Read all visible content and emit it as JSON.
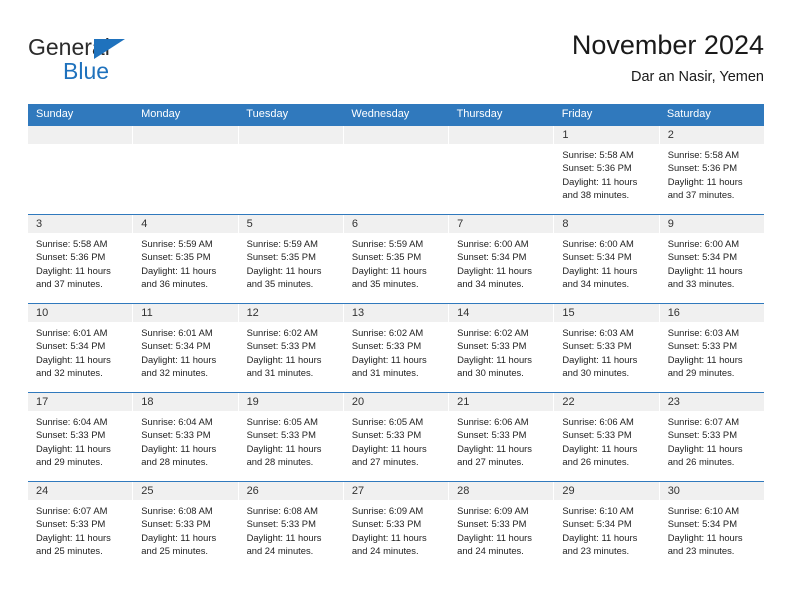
{
  "brand": {
    "name_part1": "General",
    "name_part2": "Blue",
    "accent_color": "#1f72bd"
  },
  "header": {
    "title": "November 2024",
    "location": "Dar an Nasir, Yemen"
  },
  "calendar": {
    "header_color": "#3079bd",
    "weekdays": [
      "Sunday",
      "Monday",
      "Tuesday",
      "Wednesday",
      "Thursday",
      "Friday",
      "Saturday"
    ],
    "weeks": [
      [
        {
          "day": "",
          "sunrise": "",
          "sunset": "",
          "daylight": "",
          "daylight2": ""
        },
        {
          "day": "",
          "sunrise": "",
          "sunset": "",
          "daylight": "",
          "daylight2": ""
        },
        {
          "day": "",
          "sunrise": "",
          "sunset": "",
          "daylight": "",
          "daylight2": ""
        },
        {
          "day": "",
          "sunrise": "",
          "sunset": "",
          "daylight": "",
          "daylight2": ""
        },
        {
          "day": "",
          "sunrise": "",
          "sunset": "",
          "daylight": "",
          "daylight2": ""
        },
        {
          "day": "1",
          "sunrise": "Sunrise: 5:58 AM",
          "sunset": "Sunset: 5:36 PM",
          "daylight": "Daylight: 11 hours",
          "daylight2": "and 38 minutes."
        },
        {
          "day": "2",
          "sunrise": "Sunrise: 5:58 AM",
          "sunset": "Sunset: 5:36 PM",
          "daylight": "Daylight: 11 hours",
          "daylight2": "and 37 minutes."
        }
      ],
      [
        {
          "day": "3",
          "sunrise": "Sunrise: 5:58 AM",
          "sunset": "Sunset: 5:36 PM",
          "daylight": "Daylight: 11 hours",
          "daylight2": "and 37 minutes."
        },
        {
          "day": "4",
          "sunrise": "Sunrise: 5:59 AM",
          "sunset": "Sunset: 5:35 PM",
          "daylight": "Daylight: 11 hours",
          "daylight2": "and 36 minutes."
        },
        {
          "day": "5",
          "sunrise": "Sunrise: 5:59 AM",
          "sunset": "Sunset: 5:35 PM",
          "daylight": "Daylight: 11 hours",
          "daylight2": "and 35 minutes."
        },
        {
          "day": "6",
          "sunrise": "Sunrise: 5:59 AM",
          "sunset": "Sunset: 5:35 PM",
          "daylight": "Daylight: 11 hours",
          "daylight2": "and 35 minutes."
        },
        {
          "day": "7",
          "sunrise": "Sunrise: 6:00 AM",
          "sunset": "Sunset: 5:34 PM",
          "daylight": "Daylight: 11 hours",
          "daylight2": "and 34 minutes."
        },
        {
          "day": "8",
          "sunrise": "Sunrise: 6:00 AM",
          "sunset": "Sunset: 5:34 PM",
          "daylight": "Daylight: 11 hours",
          "daylight2": "and 34 minutes."
        },
        {
          "day": "9",
          "sunrise": "Sunrise: 6:00 AM",
          "sunset": "Sunset: 5:34 PM",
          "daylight": "Daylight: 11 hours",
          "daylight2": "and 33 minutes."
        }
      ],
      [
        {
          "day": "10",
          "sunrise": "Sunrise: 6:01 AM",
          "sunset": "Sunset: 5:34 PM",
          "daylight": "Daylight: 11 hours",
          "daylight2": "and 32 minutes."
        },
        {
          "day": "11",
          "sunrise": "Sunrise: 6:01 AM",
          "sunset": "Sunset: 5:34 PM",
          "daylight": "Daylight: 11 hours",
          "daylight2": "and 32 minutes."
        },
        {
          "day": "12",
          "sunrise": "Sunrise: 6:02 AM",
          "sunset": "Sunset: 5:33 PM",
          "daylight": "Daylight: 11 hours",
          "daylight2": "and 31 minutes."
        },
        {
          "day": "13",
          "sunrise": "Sunrise: 6:02 AM",
          "sunset": "Sunset: 5:33 PM",
          "daylight": "Daylight: 11 hours",
          "daylight2": "and 31 minutes."
        },
        {
          "day": "14",
          "sunrise": "Sunrise: 6:02 AM",
          "sunset": "Sunset: 5:33 PM",
          "daylight": "Daylight: 11 hours",
          "daylight2": "and 30 minutes."
        },
        {
          "day": "15",
          "sunrise": "Sunrise: 6:03 AM",
          "sunset": "Sunset: 5:33 PM",
          "daylight": "Daylight: 11 hours",
          "daylight2": "and 30 minutes."
        },
        {
          "day": "16",
          "sunrise": "Sunrise: 6:03 AM",
          "sunset": "Sunset: 5:33 PM",
          "daylight": "Daylight: 11 hours",
          "daylight2": "and 29 minutes."
        }
      ],
      [
        {
          "day": "17",
          "sunrise": "Sunrise: 6:04 AM",
          "sunset": "Sunset: 5:33 PM",
          "daylight": "Daylight: 11 hours",
          "daylight2": "and 29 minutes."
        },
        {
          "day": "18",
          "sunrise": "Sunrise: 6:04 AM",
          "sunset": "Sunset: 5:33 PM",
          "daylight": "Daylight: 11 hours",
          "daylight2": "and 28 minutes."
        },
        {
          "day": "19",
          "sunrise": "Sunrise: 6:05 AM",
          "sunset": "Sunset: 5:33 PM",
          "daylight": "Daylight: 11 hours",
          "daylight2": "and 28 minutes."
        },
        {
          "day": "20",
          "sunrise": "Sunrise: 6:05 AM",
          "sunset": "Sunset: 5:33 PM",
          "daylight": "Daylight: 11 hours",
          "daylight2": "and 27 minutes."
        },
        {
          "day": "21",
          "sunrise": "Sunrise: 6:06 AM",
          "sunset": "Sunset: 5:33 PM",
          "daylight": "Daylight: 11 hours",
          "daylight2": "and 27 minutes."
        },
        {
          "day": "22",
          "sunrise": "Sunrise: 6:06 AM",
          "sunset": "Sunset: 5:33 PM",
          "daylight": "Daylight: 11 hours",
          "daylight2": "and 26 minutes."
        },
        {
          "day": "23",
          "sunrise": "Sunrise: 6:07 AM",
          "sunset": "Sunset: 5:33 PM",
          "daylight": "Daylight: 11 hours",
          "daylight2": "and 26 minutes."
        }
      ],
      [
        {
          "day": "24",
          "sunrise": "Sunrise: 6:07 AM",
          "sunset": "Sunset: 5:33 PM",
          "daylight": "Daylight: 11 hours",
          "daylight2": "and 25 minutes."
        },
        {
          "day": "25",
          "sunrise": "Sunrise: 6:08 AM",
          "sunset": "Sunset: 5:33 PM",
          "daylight": "Daylight: 11 hours",
          "daylight2": "and 25 minutes."
        },
        {
          "day": "26",
          "sunrise": "Sunrise: 6:08 AM",
          "sunset": "Sunset: 5:33 PM",
          "daylight": "Daylight: 11 hours",
          "daylight2": "and 24 minutes."
        },
        {
          "day": "27",
          "sunrise": "Sunrise: 6:09 AM",
          "sunset": "Sunset: 5:33 PM",
          "daylight": "Daylight: 11 hours",
          "daylight2": "and 24 minutes."
        },
        {
          "day": "28",
          "sunrise": "Sunrise: 6:09 AM",
          "sunset": "Sunset: 5:33 PM",
          "daylight": "Daylight: 11 hours",
          "daylight2": "and 24 minutes."
        },
        {
          "day": "29",
          "sunrise": "Sunrise: 6:10 AM",
          "sunset": "Sunset: 5:34 PM",
          "daylight": "Daylight: 11 hours",
          "daylight2": "and 23 minutes."
        },
        {
          "day": "30",
          "sunrise": "Sunrise: 6:10 AM",
          "sunset": "Sunset: 5:34 PM",
          "daylight": "Daylight: 11 hours",
          "daylight2": "and 23 minutes."
        }
      ]
    ]
  }
}
